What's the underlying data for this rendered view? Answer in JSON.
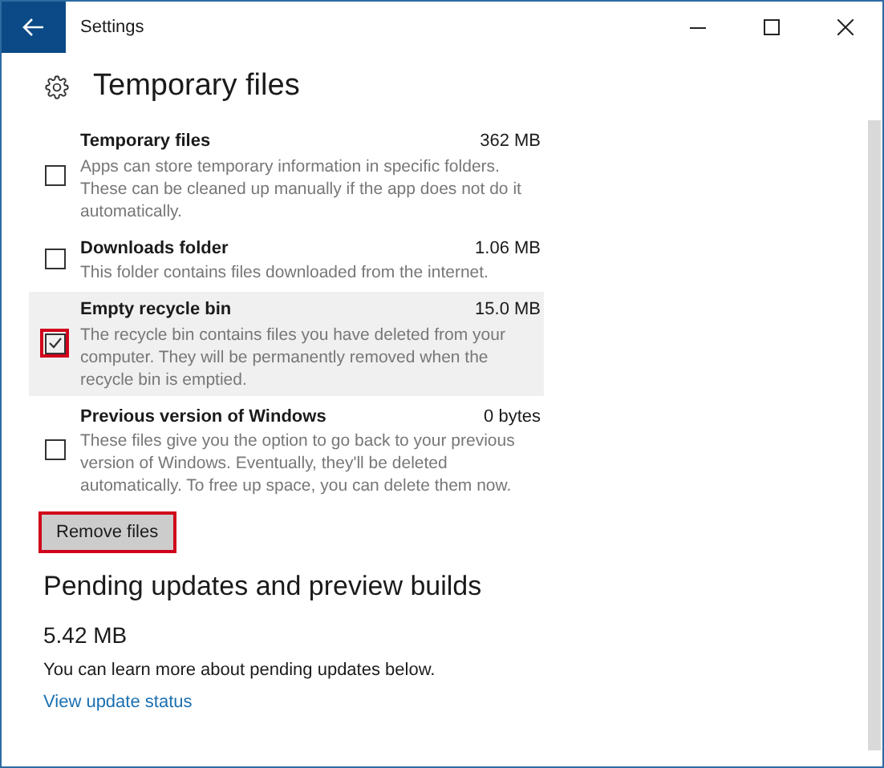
{
  "window": {
    "title": "Settings"
  },
  "page": {
    "title": "Temporary files"
  },
  "items": [
    {
      "name": "Temporary files",
      "size": "362 MB",
      "description": "Apps can store temporary information in specific folders. These can be cleaned up manually if the app does not do it automatically.",
      "checked": false,
      "selected": false,
      "highlighted": false
    },
    {
      "name": "Downloads folder",
      "size": "1.06 MB",
      "description": "This folder contains files downloaded from the internet.",
      "checked": false,
      "selected": false,
      "highlighted": false
    },
    {
      "name": "Empty recycle bin",
      "size": "15.0 MB",
      "description": "The recycle bin contains files you have deleted from your computer. They will be permanently removed when the recycle bin is emptied.",
      "checked": true,
      "selected": true,
      "highlighted": true
    },
    {
      "name": "Previous version of Windows",
      "size": "0 bytes",
      "description": "These files give you the option to go back to your previous version of Windows. Eventually, they'll be deleted automatically. To free up space, you can delete them now.",
      "checked": false,
      "selected": false,
      "highlighted": false
    }
  ],
  "remove_button": {
    "label": "Remove files",
    "highlighted": true
  },
  "pending": {
    "title": "Pending updates and preview builds",
    "size": "5.42 MB",
    "text": "You can learn more about pending updates below.",
    "link": "View update status"
  }
}
